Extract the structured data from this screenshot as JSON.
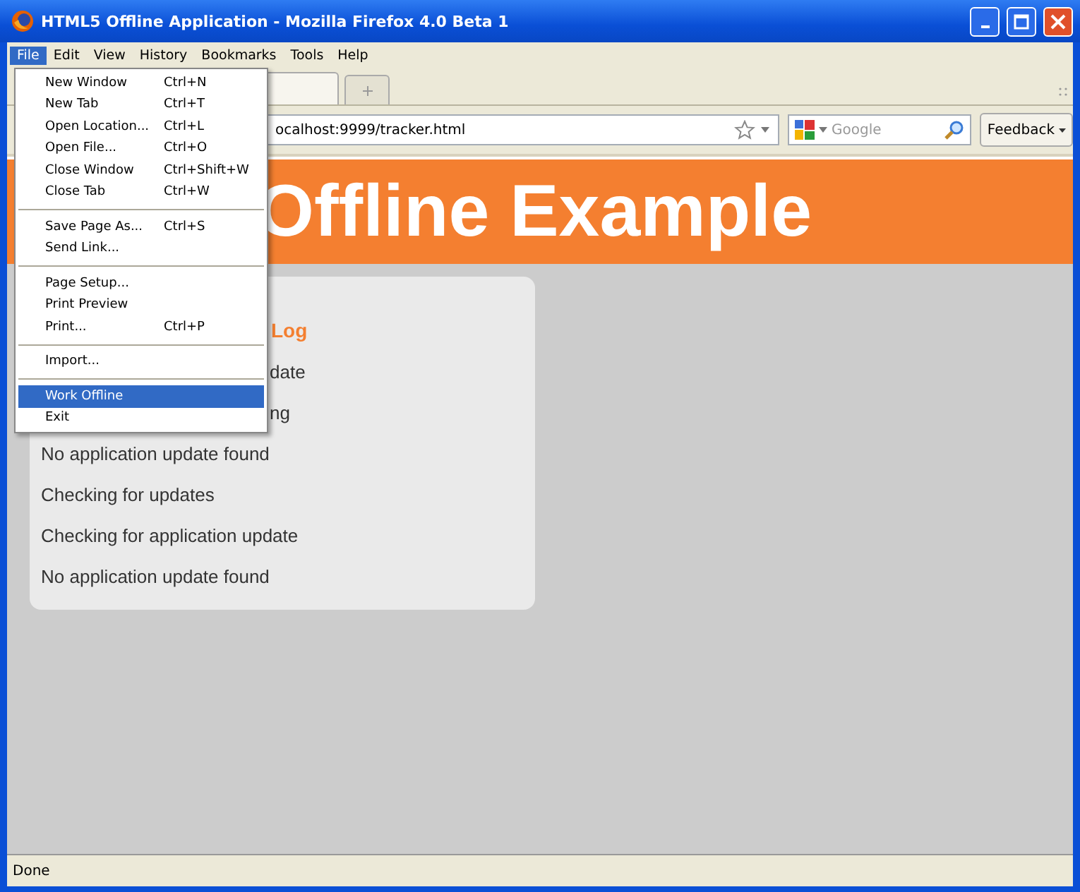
{
  "window": {
    "title": "HTML5 Offline Application - Mozilla Firefox 4.0 Beta 1"
  },
  "menu_bar": [
    {
      "label": "File",
      "selected": true
    },
    {
      "label": "Edit",
      "selected": false
    },
    {
      "label": "View",
      "selected": false
    },
    {
      "label": "History",
      "selected": false
    },
    {
      "label": "Bookmarks",
      "selected": false
    },
    {
      "label": "Tools",
      "selected": false
    },
    {
      "label": "Help",
      "selected": false
    }
  ],
  "file_menu": {
    "groups": [
      [
        {
          "label": "New Window",
          "shortcut": "Ctrl+N",
          "selected": false
        },
        {
          "label": "New Tab",
          "shortcut": "Ctrl+T",
          "selected": false
        },
        {
          "label": "Open Location...",
          "shortcut": "Ctrl+L",
          "selected": false
        },
        {
          "label": "Open File...",
          "shortcut": "Ctrl+O",
          "selected": false
        },
        {
          "label": "Close Window",
          "shortcut": "Ctrl+Shift+W",
          "selected": false
        },
        {
          "label": "Close Tab",
          "shortcut": "Ctrl+W",
          "selected": false
        }
      ],
      [
        {
          "label": "Save Page As...",
          "shortcut": "Ctrl+S",
          "selected": false
        },
        {
          "label": "Send Link...",
          "selected": false
        }
      ],
      [
        {
          "label": "Page Setup...",
          "selected": false
        },
        {
          "label": "Print Preview",
          "selected": false
        },
        {
          "label": "Print...",
          "shortcut": "Ctrl+P",
          "selected": false
        }
      ],
      [
        {
          "label": "Import...",
          "selected": false
        }
      ],
      [
        {
          "label": "Work Offline",
          "selected": true
        },
        {
          "label": "Exit",
          "selected": false
        }
      ]
    ]
  },
  "address_bar": {
    "value": "ocalhost:9999/tracker.html"
  },
  "search": {
    "placeholder": "Google"
  },
  "feedback_button": "Feedback",
  "page": {
    "heading": "Offline Example",
    "log": {
      "title": "Log",
      "entries": [
        {
          "text": "date",
          "covered": true
        },
        {
          "text": "ng",
          "covered": true
        },
        {
          "text": "No application update found",
          "covered": false
        },
        {
          "text": "Checking for updates",
          "covered": false
        },
        {
          "text": "Checking for application update",
          "covered": false
        },
        {
          "text": "No application update found",
          "covered": false
        }
      ]
    }
  },
  "status_bar": "Done"
}
